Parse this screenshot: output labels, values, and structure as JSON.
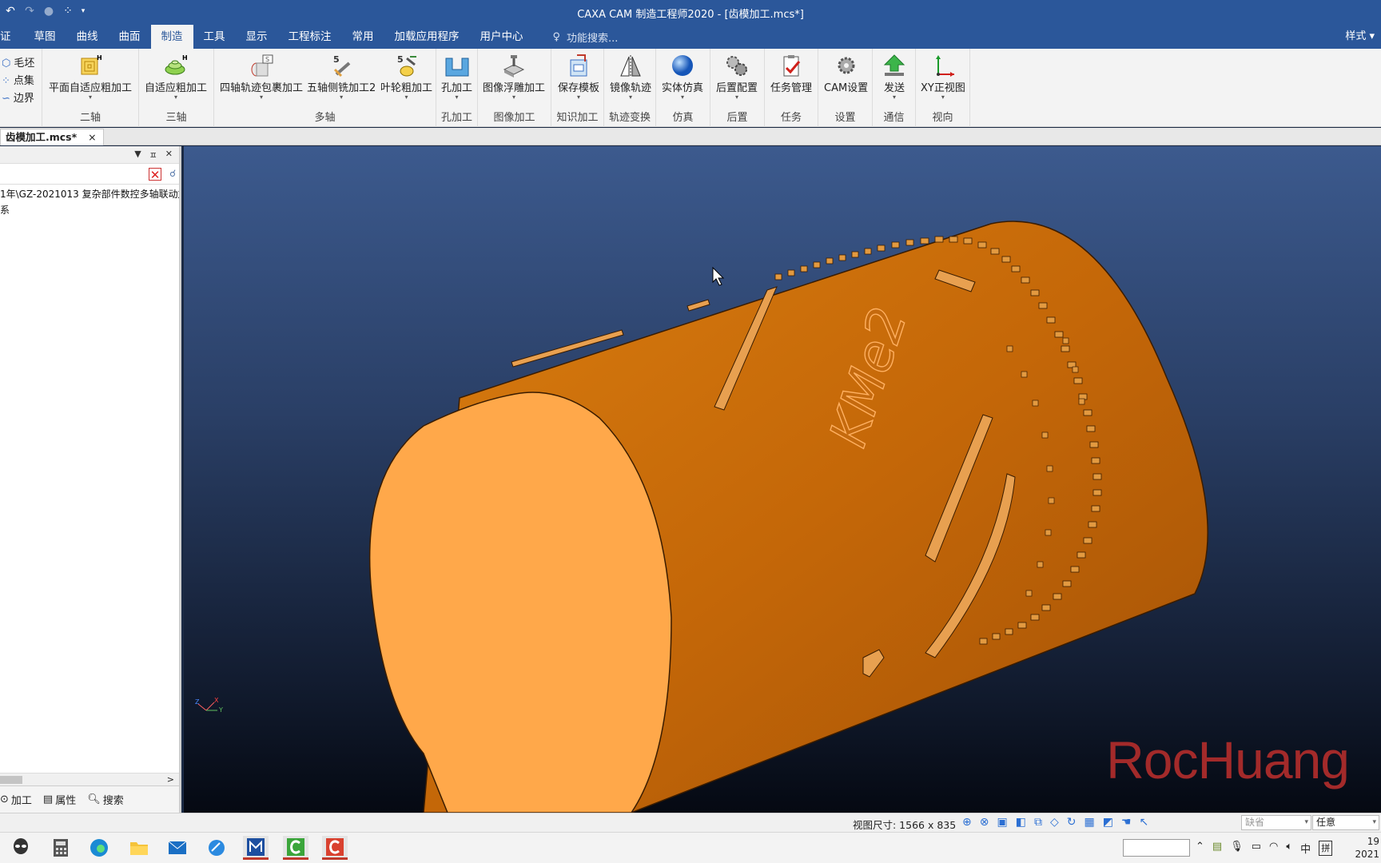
{
  "window": {
    "title": "CAXA CAM 制造工程师2020 - [齿模加工.mcs*]"
  },
  "tabs": [
    {
      "label": "证"
    },
    {
      "label": "草图"
    },
    {
      "label": "曲线"
    },
    {
      "label": "曲面"
    },
    {
      "label": "制造"
    },
    {
      "label": "工具"
    },
    {
      "label": "显示"
    },
    {
      "label": "工程标注"
    },
    {
      "label": "常用"
    },
    {
      "label": "加载应用程序"
    },
    {
      "label": "用户中心"
    }
  ],
  "tab_search": "功能搜索...",
  "tab_right": "样式",
  "ribbon": {
    "small_items": [
      "毛坯",
      "点集",
      "边界"
    ],
    "buttons": {
      "planar_rough": "平面自适应粗加工",
      "adaptive_rough": "自适应粗加工",
      "four_axis_wrap": "四轴轨迹包裹加工",
      "five_axis_side": "五轴侧铣加工2",
      "impeller_rough": "叶轮粗加工",
      "hole": "孔加工",
      "image_relief": "图像浮雕加工",
      "save_template": "保存模板",
      "mirror_path": "镜像轨迹",
      "solid_sim": "实体仿真",
      "post_config": "后置配置",
      "task_manage": "任务管理",
      "cam_settings": "CAM设置",
      "send": "发送",
      "xy_view": "XY正视图"
    },
    "groups": {
      "two_axis": "二轴",
      "three_axis": "三轴",
      "multi_axis": "多轴",
      "hole": "孔加工",
      "image": "图像加工",
      "knowledge": "知识加工",
      "transform": "轨迹变换",
      "sim": "仿真",
      "post": "后置",
      "task": "任务",
      "settings": "设置",
      "comm": "通信",
      "view": "视向"
    }
  },
  "doc_tab": {
    "label": "齿模加工.mcs*",
    "close": "×"
  },
  "left_panel": {
    "tree": [
      "1年\\GZ-2021013 复杂部件数控多轴联动加",
      "系"
    ],
    "bottom_tabs": [
      "加工",
      "属性",
      "搜索"
    ]
  },
  "viewport": {
    "engraved_text": "KMe2",
    "watermark": "RocHuang",
    "part_color": "#c86a08",
    "part_face_color": "#ffa84a"
  },
  "statusbar": {
    "view_size": "视图尺寸: 1566 x  835",
    "combo1": "缺省",
    "combo2": "任意"
  },
  "taskbar": {
    "tray_lang": "中",
    "tray_ime": "拼",
    "clock_line1": "19",
    "clock_line2": "2021"
  }
}
